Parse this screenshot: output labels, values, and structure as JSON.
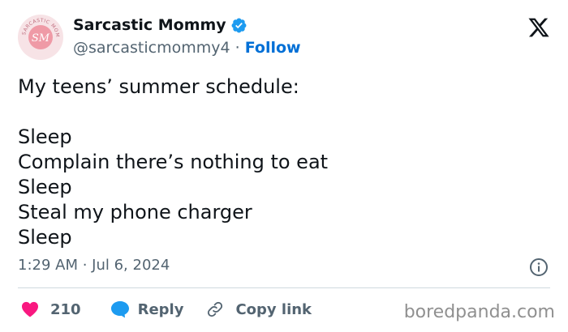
{
  "author": {
    "avatar_text": "SM",
    "avatar_ring_text": "SARCASTIC MOMMY",
    "display_name": "Sarcastic Mommy",
    "handle": "@sarcasticmommy4",
    "separator": " · ",
    "follow_label": "Follow",
    "verified": true
  },
  "tweet": {
    "lines": [
      "My teens’ summer schedule:",
      "",
      "Sleep",
      "Complain there’s nothing to eat",
      "Sleep",
      "Steal my phone charger",
      "Sleep"
    ],
    "timestamp": "1:29 AM · Jul 6, 2024"
  },
  "actions": {
    "like_count": "210",
    "reply_label": "Reply",
    "copy_label": "Copy link"
  },
  "watermark": "boredpanda.com",
  "colors": {
    "like": "#f91880",
    "reply": "#1d9bf0",
    "follow": "#006fd6",
    "verified": "#1d9bf0",
    "muted": "#536471"
  },
  "icons": {
    "logo": "x-logo-icon",
    "verified": "verified-badge-icon",
    "info": "info-icon",
    "like": "heart-icon",
    "reply": "speech-bubble-icon",
    "copy": "link-icon"
  }
}
